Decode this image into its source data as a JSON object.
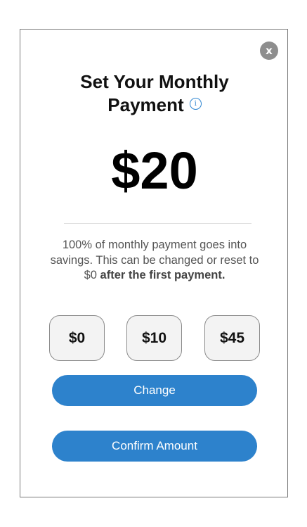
{
  "modal": {
    "close_label": "x",
    "title_line1": "Set Your Monthly",
    "title_line2": "Payment",
    "info_icon_glyph": "i",
    "amount": "$20",
    "description_text": "100% of monthly payment goes into savings. This can be changed or reset to $0",
    "description_emphasis": "after the first payment.",
    "options": [
      "$0",
      "$10",
      "$45"
    ],
    "change_label": "Change",
    "confirm_label": "Confirm Amount"
  },
  "colors": {
    "primary_button": "#2d82cc",
    "info_icon": "#2f86d1",
    "close_button": "#8e8e8e",
    "option_background": "#f3f3f3"
  },
  "icons": [
    "close-icon",
    "info-icon"
  ]
}
